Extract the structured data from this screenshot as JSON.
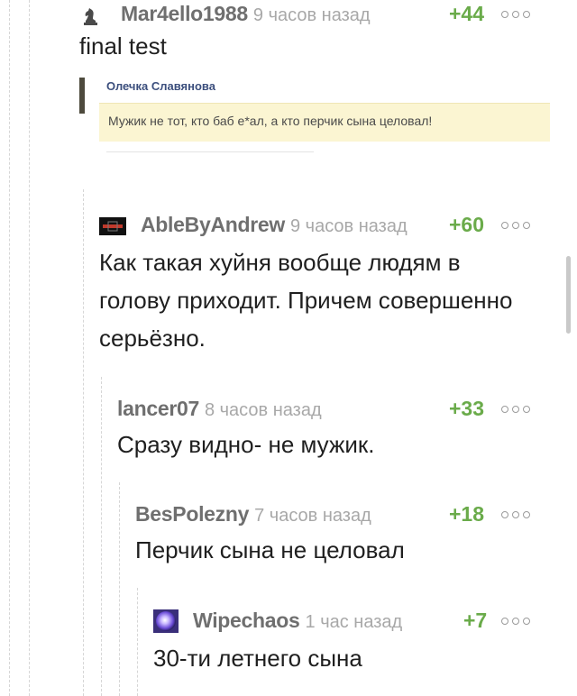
{
  "comments": [
    {
      "author": "Mar4ello1988",
      "time": "9 часов назад",
      "rating": "+44",
      "text": "final test",
      "avatar_icon": "chess-knight-icon",
      "embed": {
        "author": "Олечка Славянова",
        "text": "Мужик не тот, кто баб е*ал, а кто перчик сына целовал!"
      }
    },
    {
      "author": "AbleByAndrew",
      "time": "9 часов назад",
      "rating": "+60",
      "text": "Как такая хуйня вообще людям в\nголову приходит. Причем совершенно\nсерьёзно.",
      "avatar_icon": "dark-logo-avatar-icon"
    },
    {
      "author": "lancer07",
      "time": "8 часов назад",
      "rating": "+33",
      "text": "Сразу видно- не мужик."
    },
    {
      "author": "BesPolezny",
      "time": "7 часов назад",
      "rating": "+18",
      "text": "Перчик сына не целовал"
    },
    {
      "author": "Wipechaos",
      "time": "1 час назад",
      "rating": "+7",
      "text": "30-ти летнего сына",
      "avatar_icon": "purple-orb-avatar-icon"
    }
  ],
  "colors": {
    "rating": "#6aab4a",
    "author": "#6f6f6f",
    "time": "#a8a8a8",
    "thread_line": "#d6d6d6",
    "quote_background": "#fbf5d2"
  }
}
